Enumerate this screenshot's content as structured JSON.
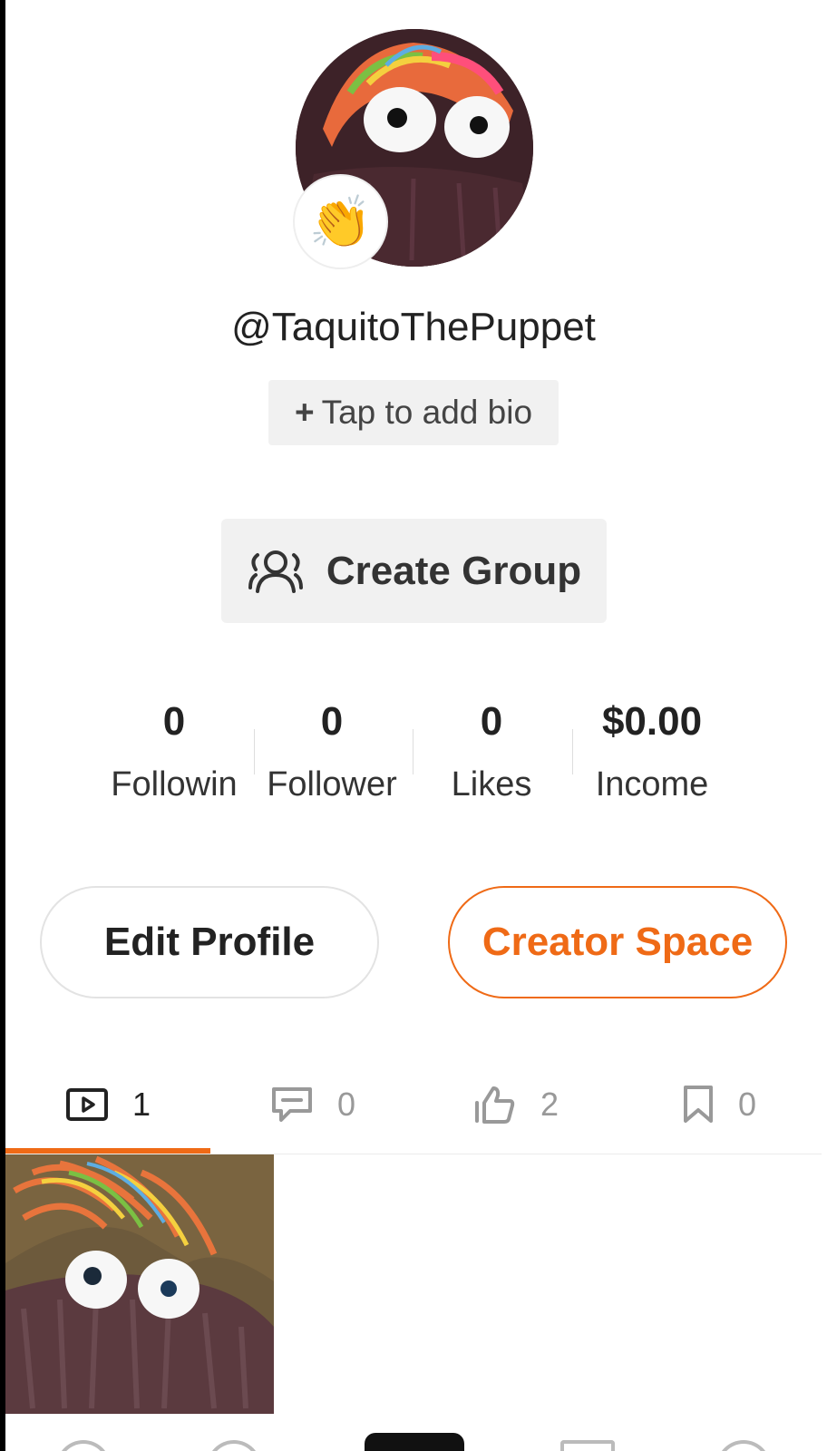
{
  "profile": {
    "username": "@TaquitoThePuppet",
    "badge_emoji": "👏",
    "bio_placeholder": "Tap to add bio",
    "bio_plus": "+"
  },
  "create_group": {
    "label": "Create Group",
    "icon": "group-icon"
  },
  "stats": [
    {
      "value": "0",
      "label": "Followin"
    },
    {
      "value": "0",
      "label": "Follower"
    },
    {
      "value": "0",
      "label": "Likes"
    },
    {
      "value": "$0.00",
      "label": "Income"
    }
  ],
  "actions": {
    "edit_profile": "Edit Profile",
    "creator_space": "Creator Space"
  },
  "tabs": [
    {
      "icon": "video-icon",
      "count": "1",
      "active": true
    },
    {
      "icon": "comment-icon",
      "count": "0",
      "active": false
    },
    {
      "icon": "thumbs-up-icon",
      "count": "2",
      "active": false
    },
    {
      "icon": "bookmark-icon",
      "count": "0",
      "active": false
    }
  ],
  "colors": {
    "accent": "#ef6a16",
    "chip_bg": "#f1f1f1"
  }
}
